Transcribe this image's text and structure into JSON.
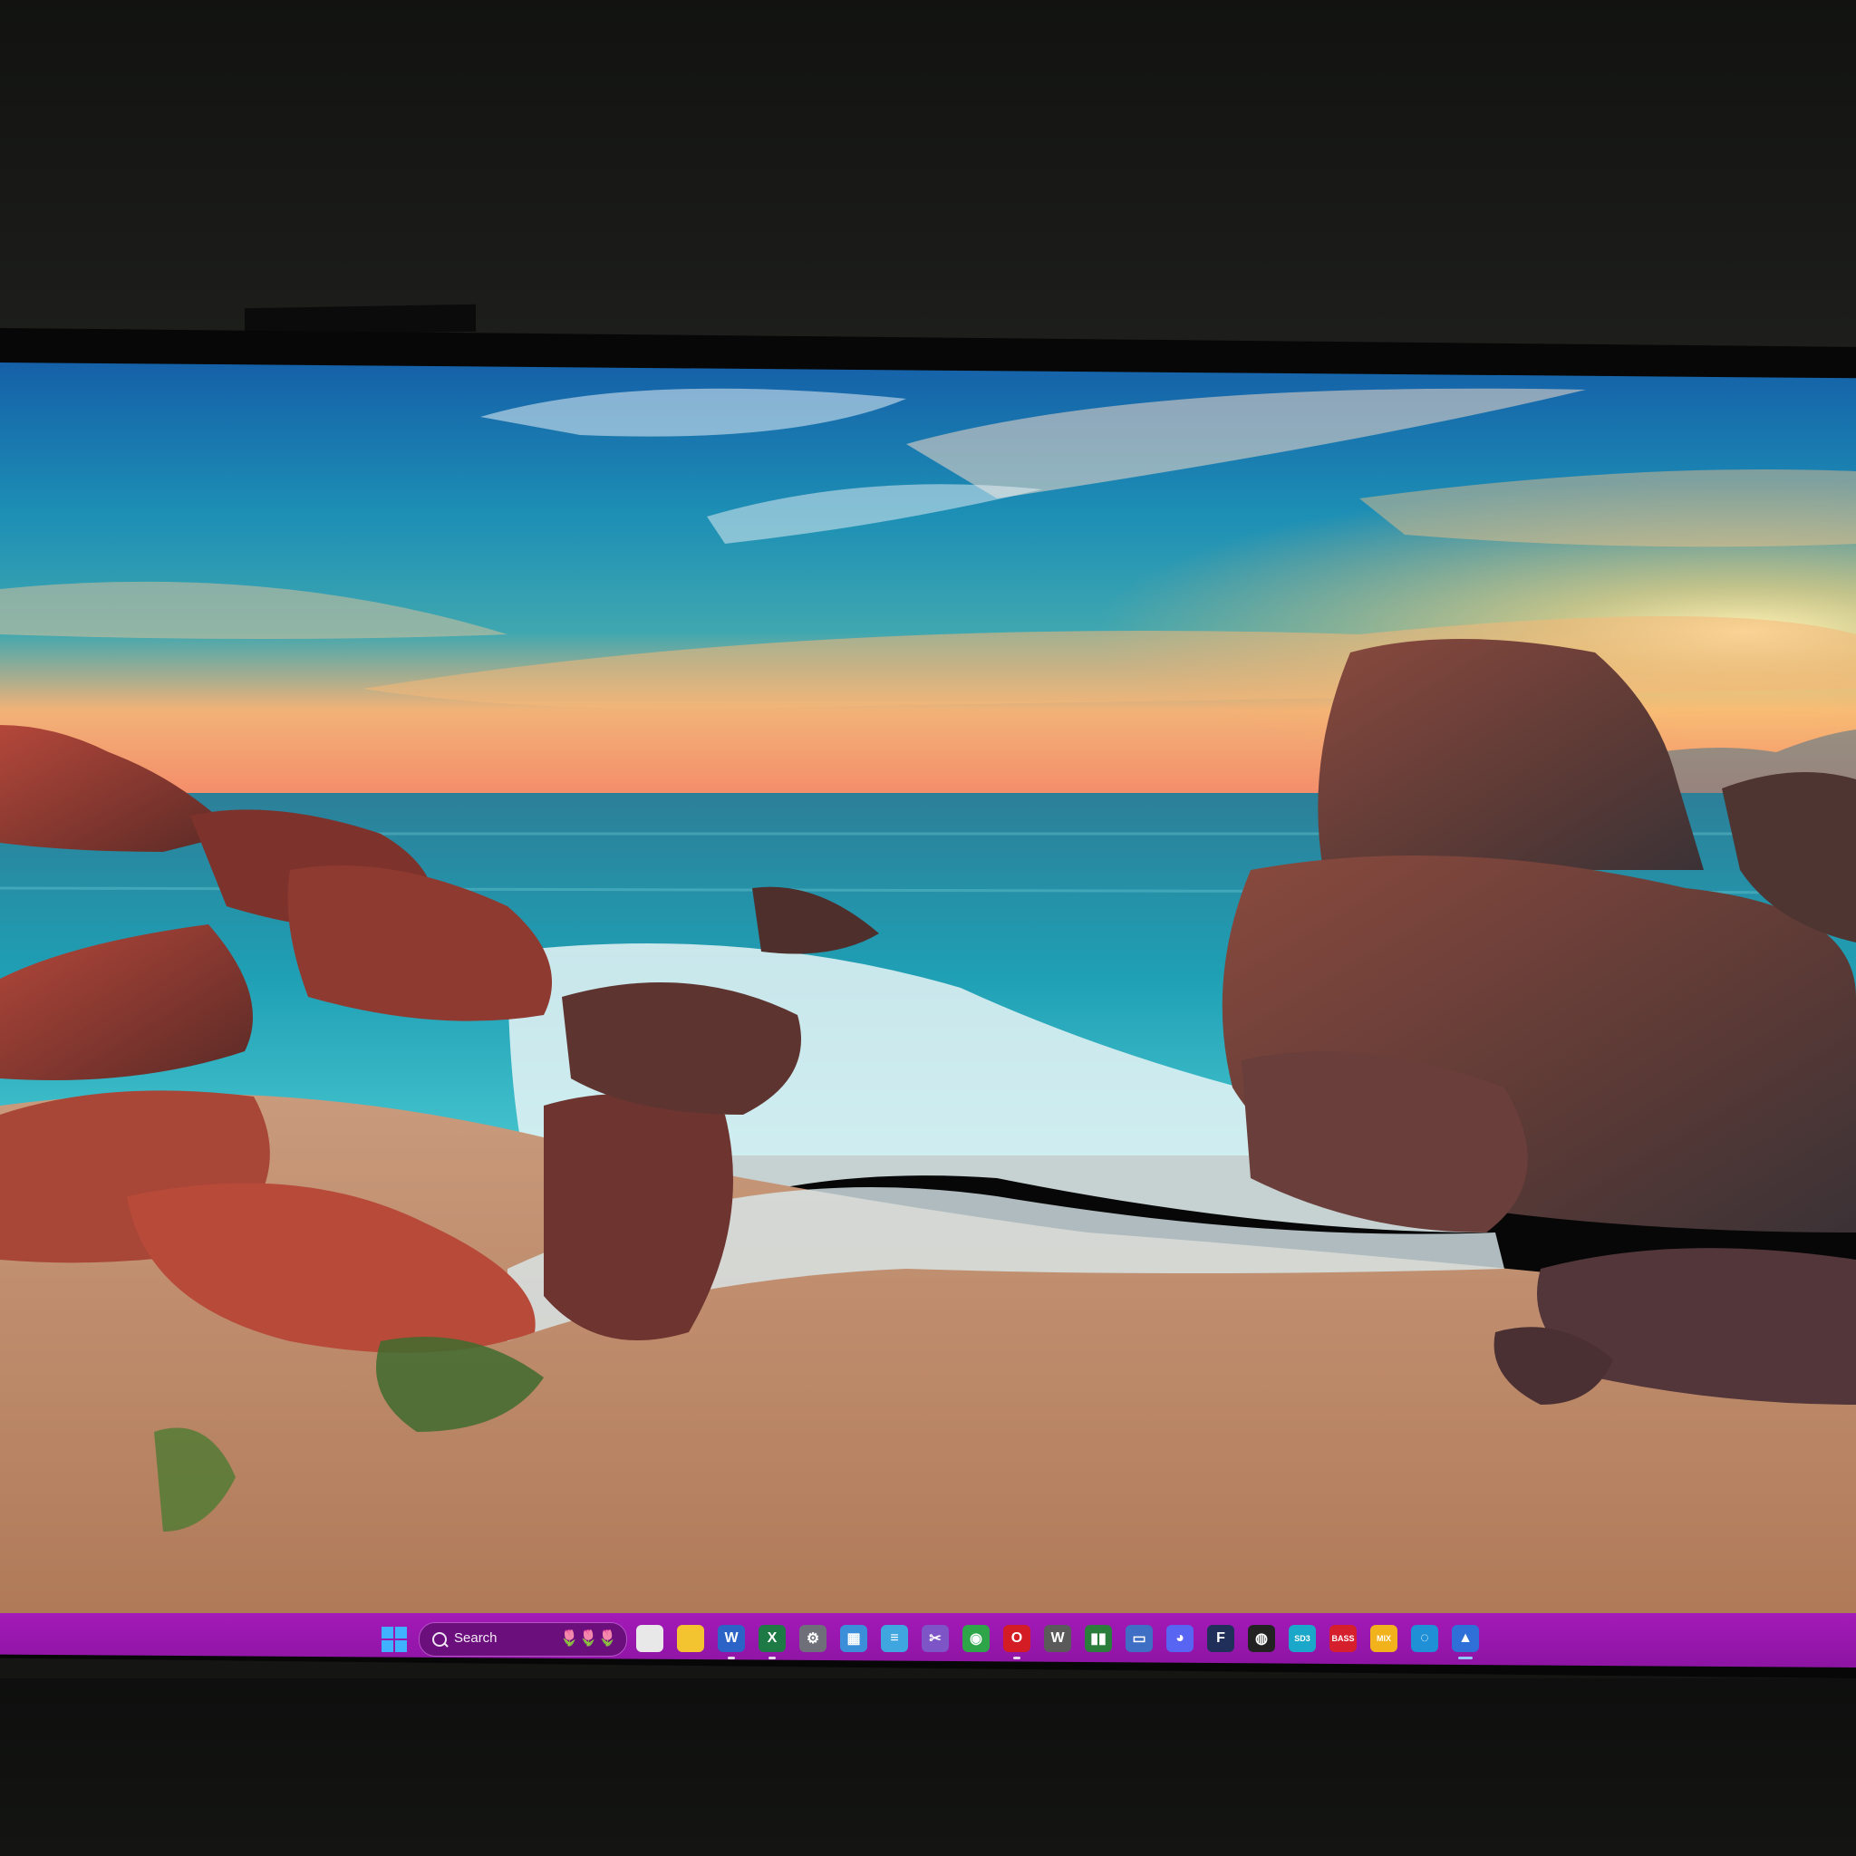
{
  "taskbar": {
    "search_label": "Search",
    "search_decoration": "🌷🌷🌷",
    "accent_color": "#9b17b0",
    "icons": [
      {
        "name": "file-manager-icon",
        "glyph": "",
        "color": "#e8e8e8"
      },
      {
        "name": "folder-icon",
        "glyph": "",
        "color": "#f4c430"
      },
      {
        "name": "word-icon",
        "glyph": "W",
        "color": "#2b63c6"
      },
      {
        "name": "excel-icon",
        "glyph": "X",
        "color": "#1d7a45"
      },
      {
        "name": "settings-icon",
        "glyph": "⚙",
        "color": "#6f6f7a"
      },
      {
        "name": "calculator-icon",
        "glyph": "▦",
        "color": "#3b8fd8"
      },
      {
        "name": "notepad-icon",
        "glyph": "≡",
        "color": "#3fa6e0"
      },
      {
        "name": "snipping-tool-icon",
        "glyph": "✂",
        "color": "#7d55c7"
      },
      {
        "name": "chrome-icon",
        "glyph": "◉",
        "color": "#2fa54a"
      },
      {
        "name": "opera-icon",
        "glyph": "O",
        "color": "#d31c24"
      },
      {
        "name": "audio-plugin-icon",
        "glyph": "W",
        "color": "#5a5a5a"
      },
      {
        "name": "media-app-icon",
        "glyph": "▮▮",
        "color": "#2a7d3a"
      },
      {
        "name": "window-app-icon",
        "glyph": "▭",
        "color": "#3e6fc4"
      },
      {
        "name": "discord-icon",
        "glyph": "◕",
        "color": "#5865f2"
      },
      {
        "name": "fender-icon",
        "glyph": "F",
        "color": "#1f2f5a"
      },
      {
        "name": "dark-app-icon",
        "glyph": "◍",
        "color": "#222222"
      },
      {
        "name": "sd3-icon",
        "glyph": "SD3",
        "color": "#1aa7c9"
      },
      {
        "name": "bass-icon",
        "glyph": "BASS",
        "color": "#d61f2c"
      },
      {
        "name": "mixer-icon",
        "glyph": "MIX",
        "color": "#f2b21c"
      },
      {
        "name": "circle-app-icon",
        "glyph": "◌",
        "color": "#1f8fd6"
      },
      {
        "name": "photo-app-icon",
        "glyph": "▲",
        "color": "#2f6fd8"
      }
    ]
  }
}
